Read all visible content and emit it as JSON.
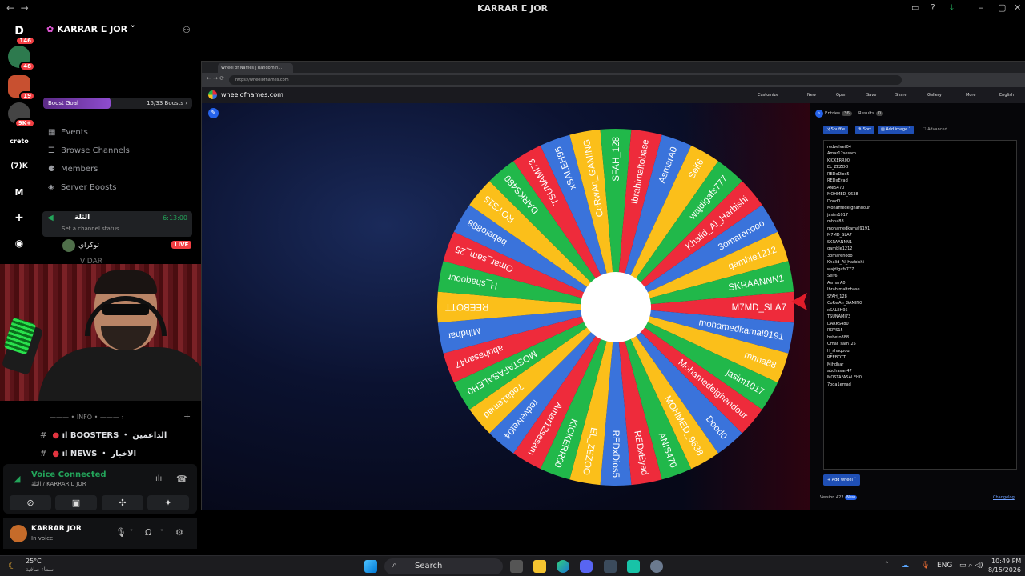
{
  "window": {
    "title": "KARRAR ⵎ JOR"
  },
  "rail": {
    "servers": [
      {
        "label": "D",
        "badge": "146"
      },
      {
        "label": "",
        "badge": "48"
      },
      {
        "label": "",
        "badge": "19"
      },
      {
        "label": "",
        "badge": "9K+"
      },
      {
        "label": "creto",
        "badge": ""
      },
      {
        "label": "(7)K",
        "badge": ""
      },
      {
        "label": "M",
        "badge": ""
      }
    ]
  },
  "sidebar": {
    "server_name": "KARRAR ⵎ JOR",
    "boost_goal": "Boost Goal",
    "boost_count": "15/33 Boosts",
    "items": [
      {
        "label": "Events"
      },
      {
        "label": "Browse Channels"
      },
      {
        "label": "Members"
      },
      {
        "label": "Server Boosts"
      }
    ],
    "voice_channel": {
      "name": "الثلة",
      "time": "6:13:00",
      "status": "Set a channel status",
      "member": "توكراي",
      "live": "LIVE"
    },
    "partial_name": "VIDAR",
    "category": "INFO",
    "channels": [
      {
        "label": "BOOSTERS ・ الداعمين"
      },
      {
        "label": "NEWS ・ الاخبار"
      }
    ]
  },
  "voice": {
    "status": "Voice Connected",
    "channel": "الثلة / KARRAR ⵎ JOR"
  },
  "user": {
    "name": "KARRAR JOR",
    "status": "In voice"
  },
  "browser": {
    "tab_title": "Wheel of Names | Random n...",
    "url": "https://wheelofnames.com",
    "site": "wheelofnames.com",
    "menu": [
      "Customize",
      "New",
      "Open",
      "Save",
      "Share",
      "Gallery",
      "More",
      "English"
    ],
    "tabs": {
      "entries": "Entries",
      "entries_count": "36",
      "results": "Results",
      "results_count": "0"
    },
    "buttons": {
      "shuffle": "Shuffle",
      "sort": "Sort",
      "add_image": "Add image",
      "advanced": "Advanced",
      "add_wheel": "Add wheel"
    },
    "version": "Version 422",
    "version_badge": "New",
    "changelog": "Changelog"
  },
  "entries": [
    "redvelvet04",
    "Amar12sesam",
    "KICKERR00",
    "EL_ZEZOO",
    "REDxDios5",
    "REDxEyad",
    "ANIS470",
    "MOHMED_9638",
    "Dood0",
    "Mohamedelghandour",
    "jasim1017",
    "mhna88",
    "mohamedkamal9191",
    "M7MD_SLA7",
    "SKRAANNN1",
    "gamble1212",
    "3omarenooo",
    "Khalid_Al_Harbishi",
    "wajdigafs777",
    "Seif6",
    "AsmarA0",
    "Ibrahimaltobase",
    "SFAH_128",
    "CoRwAn_GAMING",
    "xSALEH95",
    "TSUNAMI73",
    "DARKS480",
    "ROYS15",
    "bebeto888",
    "Omar_sam_25",
    "H_shaqoour",
    "REEBOTT",
    "Mihdhar",
    "abohasan47",
    "MOSTAFASALEH0",
    "7oda1emad"
  ],
  "wheel": {
    "segments": [
      "M7MD_SLA7",
      "mohamedkamal9191",
      "mhna88",
      "jasim1017",
      "Mohamedelghandour",
      "Dood0",
      "MOHMED_9638",
      "ANIS470",
      "REDxEyad",
      "REDxDios5",
      "EL_ZEZOO",
      "KICKERR00",
      "Amar12sesam",
      "redvelvet04",
      "7oda1emad",
      "MOSTAFASALEH0",
      "abohasan47",
      "Mihdhar",
      "REEBOTT",
      "H_shaqoour",
      "Omar_sam_25",
      "bebeto888",
      "ROYS15",
      "DARKS480",
      "TSUNAMI73",
      "xSALEH95",
      "CoRwAn_GAMING",
      "SFAH_128",
      "Ibrahimaltobase",
      "AsmarA0",
      "Seif6",
      "wajdigafs777",
      "Khalid_Al_Harbishi",
      "3omarenooo",
      "gamble1212",
      "SKRAANNN1"
    ],
    "colors": [
      "#ee2b3b",
      "#3a73db",
      "#fbbf1a",
      "#21b84a"
    ]
  },
  "taskbar": {
    "weather_temp": "25°C",
    "weather_desc": "سماء صافية",
    "search": "Search",
    "lang": "ENG",
    "time": "10:49 PM",
    "date": "8/15/2026"
  }
}
